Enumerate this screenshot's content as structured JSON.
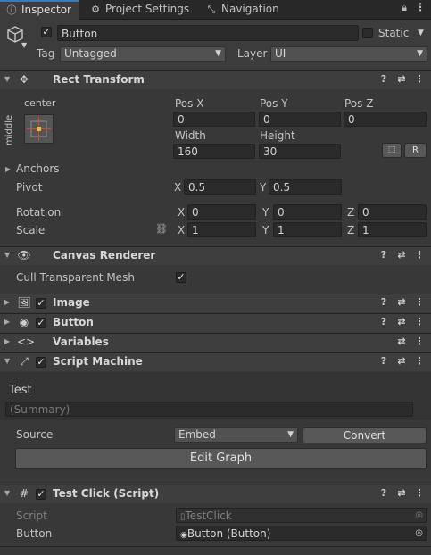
{
  "tabs": [
    {
      "label": "Inspector",
      "icon": "info-icon"
    },
    {
      "label": "Project Settings",
      "icon": "gear-icon"
    },
    {
      "label": "Navigation",
      "icon": "navigation-icon"
    }
  ],
  "gameobject": {
    "name": "Button",
    "static_label": "Static",
    "tag_label": "Tag",
    "tag_value": "Untagged",
    "layer_label": "Layer",
    "layer_value": "UI"
  },
  "rect_transform": {
    "title": "Rect Transform",
    "anchor_h": "center",
    "anchor_v": "middle",
    "pos_x_label": "Pos X",
    "pos_y_label": "Pos Y",
    "pos_z_label": "Pos Z",
    "pos_x": "0",
    "pos_y": "0",
    "pos_z": "0",
    "width_label": "Width",
    "height_label": "Height",
    "width": "160",
    "height": "30",
    "r_label": "R",
    "anchors_label": "Anchors",
    "pivot_label": "Pivot",
    "pivot_x": "0.5",
    "pivot_y": "0.5",
    "rotation_label": "Rotation",
    "rot_x": "0",
    "rot_y": "0",
    "rot_z": "0",
    "scale_label": "Scale",
    "scale_x": "1",
    "scale_y": "1",
    "scale_z": "1",
    "x": "X",
    "y": "Y",
    "z": "Z"
  },
  "canvas_renderer": {
    "title": "Canvas Renderer",
    "cull_label": "Cull Transparent Mesh"
  },
  "image": {
    "title": "Image"
  },
  "button_comp": {
    "title": "Button"
  },
  "variables": {
    "title": "Variables"
  },
  "script_machine": {
    "title": "Script Machine",
    "graph_title": "Test",
    "summary_placeholder": "(Summary)",
    "source_label": "Source",
    "source_value": "Embed",
    "convert_label": "Convert",
    "edit_graph_label": "Edit Graph"
  },
  "test_click": {
    "title": "Test Click (Script)",
    "script_label": "Script",
    "script_value": "TestClick",
    "button_label": "Button",
    "button_value": "Button (Button)"
  },
  "colors": {
    "accent": "#3a79bb",
    "background": "#383838",
    "header": "#3e3e3e"
  }
}
